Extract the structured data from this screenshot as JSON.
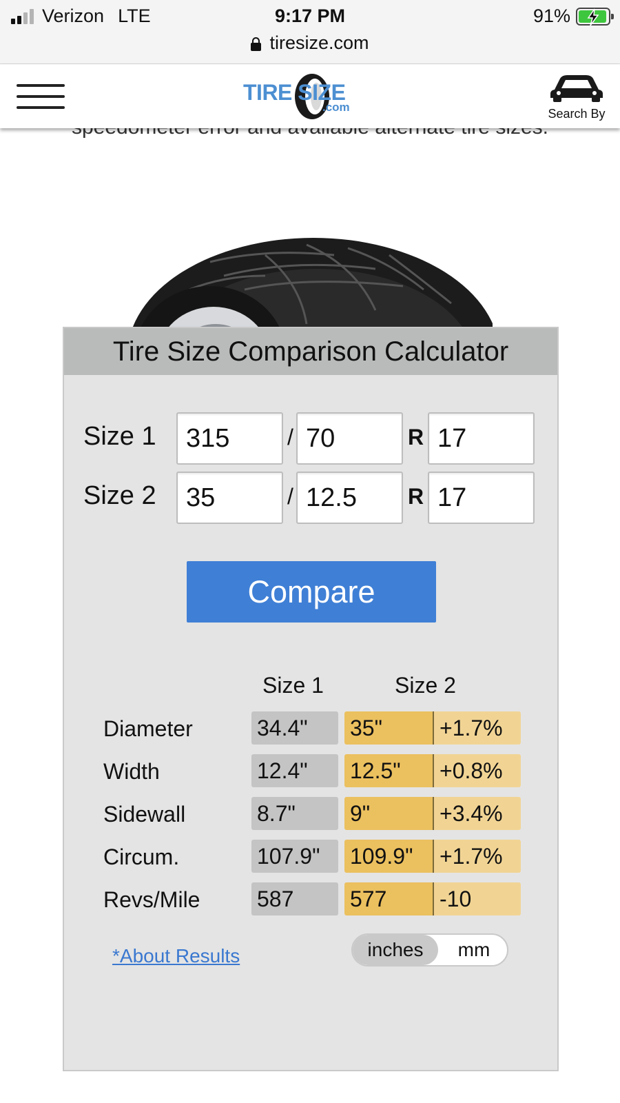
{
  "status_bar": {
    "carrier": "Verizon",
    "network": "LTE",
    "time": "9:17 PM",
    "battery": "91%",
    "url": "tiresize.com"
  },
  "header": {
    "logo_main": "TIRE SIZE",
    "logo_suffix": ".com",
    "search_by_label": "Search By"
  },
  "page": {
    "partial_text": "speedometer error and available alternate tire sizes."
  },
  "calculator": {
    "title": "Tire Size Comparison Calculator",
    "size1": {
      "label": "Size 1",
      "width": "315",
      "ratio": "70",
      "rim": "17"
    },
    "size2": {
      "label": "Size 2",
      "width": "35",
      "ratio": "12.5",
      "rim": "17"
    },
    "slash": "/",
    "r": "R",
    "compare_label": "Compare",
    "columns": {
      "size1": "Size 1",
      "size2": "Size 2"
    },
    "results": [
      {
        "label": "Diameter",
        "s1": "34.4\"",
        "s2": "35\"",
        "diff": "+1.7%"
      },
      {
        "label": "Width",
        "s1": "12.4\"",
        "s2": "12.5\"",
        "diff": "+0.8%"
      },
      {
        "label": "Sidewall",
        "s1": "8.7\"",
        "s2": "9\"",
        "diff": "+3.4%"
      },
      {
        "label": "Circum.",
        "s1": "107.9\"",
        "s2": "109.9\"",
        "diff": "+1.7%"
      },
      {
        "label": "Revs/Mile",
        "s1": "587",
        "s2": "577",
        "diff": "-10"
      }
    ],
    "about_link": "*About Results",
    "units": {
      "active": "inches",
      "other": "mm"
    }
  },
  "colors": {
    "brand_blue": "#4c8fd2",
    "button_blue": "#3f7fd6",
    "size1_cell": "#c4c4c4",
    "size2_cell": "#ebc05f",
    "diff_cell": "#f1d494",
    "battery_green": "#3ec73e"
  }
}
